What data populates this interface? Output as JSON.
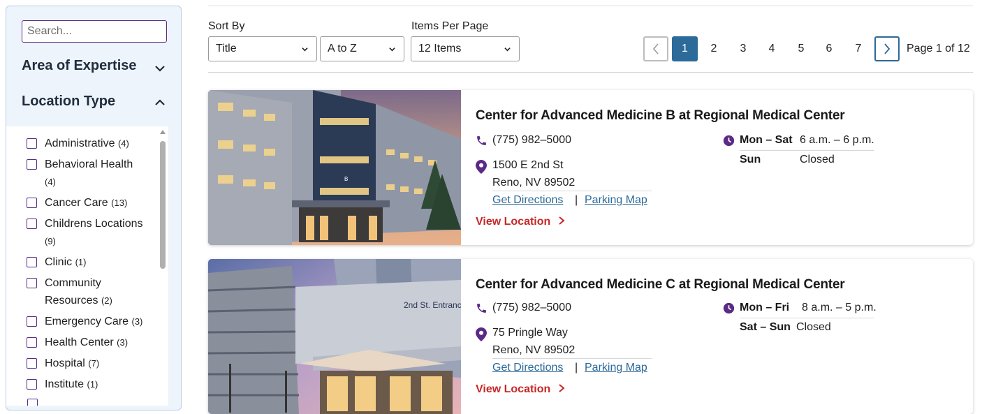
{
  "sidebar": {
    "search_placeholder": "Search...",
    "area_heading": "Area of Expertise",
    "location_heading": "Location Type",
    "filters": [
      {
        "label": "Administrative",
        "count": "(4)"
      },
      {
        "label": "Behavioral Health",
        "count": "(4)"
      },
      {
        "label": "Cancer Care",
        "count": "(13)"
      },
      {
        "label": "Childrens Locations",
        "count": "(9)"
      },
      {
        "label": "Clinic",
        "count": "(1)"
      },
      {
        "label": "Community Resources",
        "count": "(2)"
      },
      {
        "label": "Emergency Care",
        "count": "(3)"
      },
      {
        "label": "Health Center",
        "count": "(3)"
      },
      {
        "label": "Hospital",
        "count": "(7)"
      },
      {
        "label": "Institute",
        "count": "(1)"
      }
    ]
  },
  "controls": {
    "sort_label": "Sort By",
    "sort_field": "Title",
    "sort_order": "A to Z",
    "per_page_label": "Items Per Page",
    "per_page": "12 Items"
  },
  "pagination": {
    "current": "1",
    "pages": [
      "2",
      "3",
      "4",
      "5",
      "6",
      "7"
    ],
    "status": "Page 1 of 12"
  },
  "locations": [
    {
      "title": "Center for Advanced Medicine B at Regional Medical Center",
      "phone": "(775) 982–5000",
      "address1": "1500 E 2nd St",
      "address2": "Reno, NV 89502",
      "directions": "Get Directions",
      "separator": "|",
      "parking": "Parking Map",
      "view": "View Location",
      "hours": [
        {
          "days": "Mon – Sat",
          "time": "6 a.m. – 6 p.m."
        },
        {
          "days": "Sun",
          "time": "Closed"
        }
      ],
      "sign_text": "B"
    },
    {
      "title": "Center for Advanced Medicine C at Regional Medical Center",
      "phone": "(775) 982–5000",
      "address1": "75 Pringle Way",
      "address2": "Reno, NV 89502",
      "directions": "Get Directions",
      "separator": "|",
      "parking": "Parking Map",
      "view": "View Location",
      "hours": [
        {
          "days": "Mon – Fri",
          "time": "8 a.m. – 5 p.m."
        },
        {
          "days": "Sat – Sun",
          "time": "Closed"
        }
      ],
      "sign_text": "2nd St. Entranc"
    }
  ],
  "colors": {
    "accent_purple": "#5b2a86",
    "link_blue": "#2c6a99",
    "view_red": "#c62828",
    "sidebar_bg": "#eef4fb"
  },
  "icons": {
    "phone": "phone-icon",
    "pin": "map-pin-icon",
    "clock": "clock-icon",
    "chevron": "chevron-icon"
  }
}
